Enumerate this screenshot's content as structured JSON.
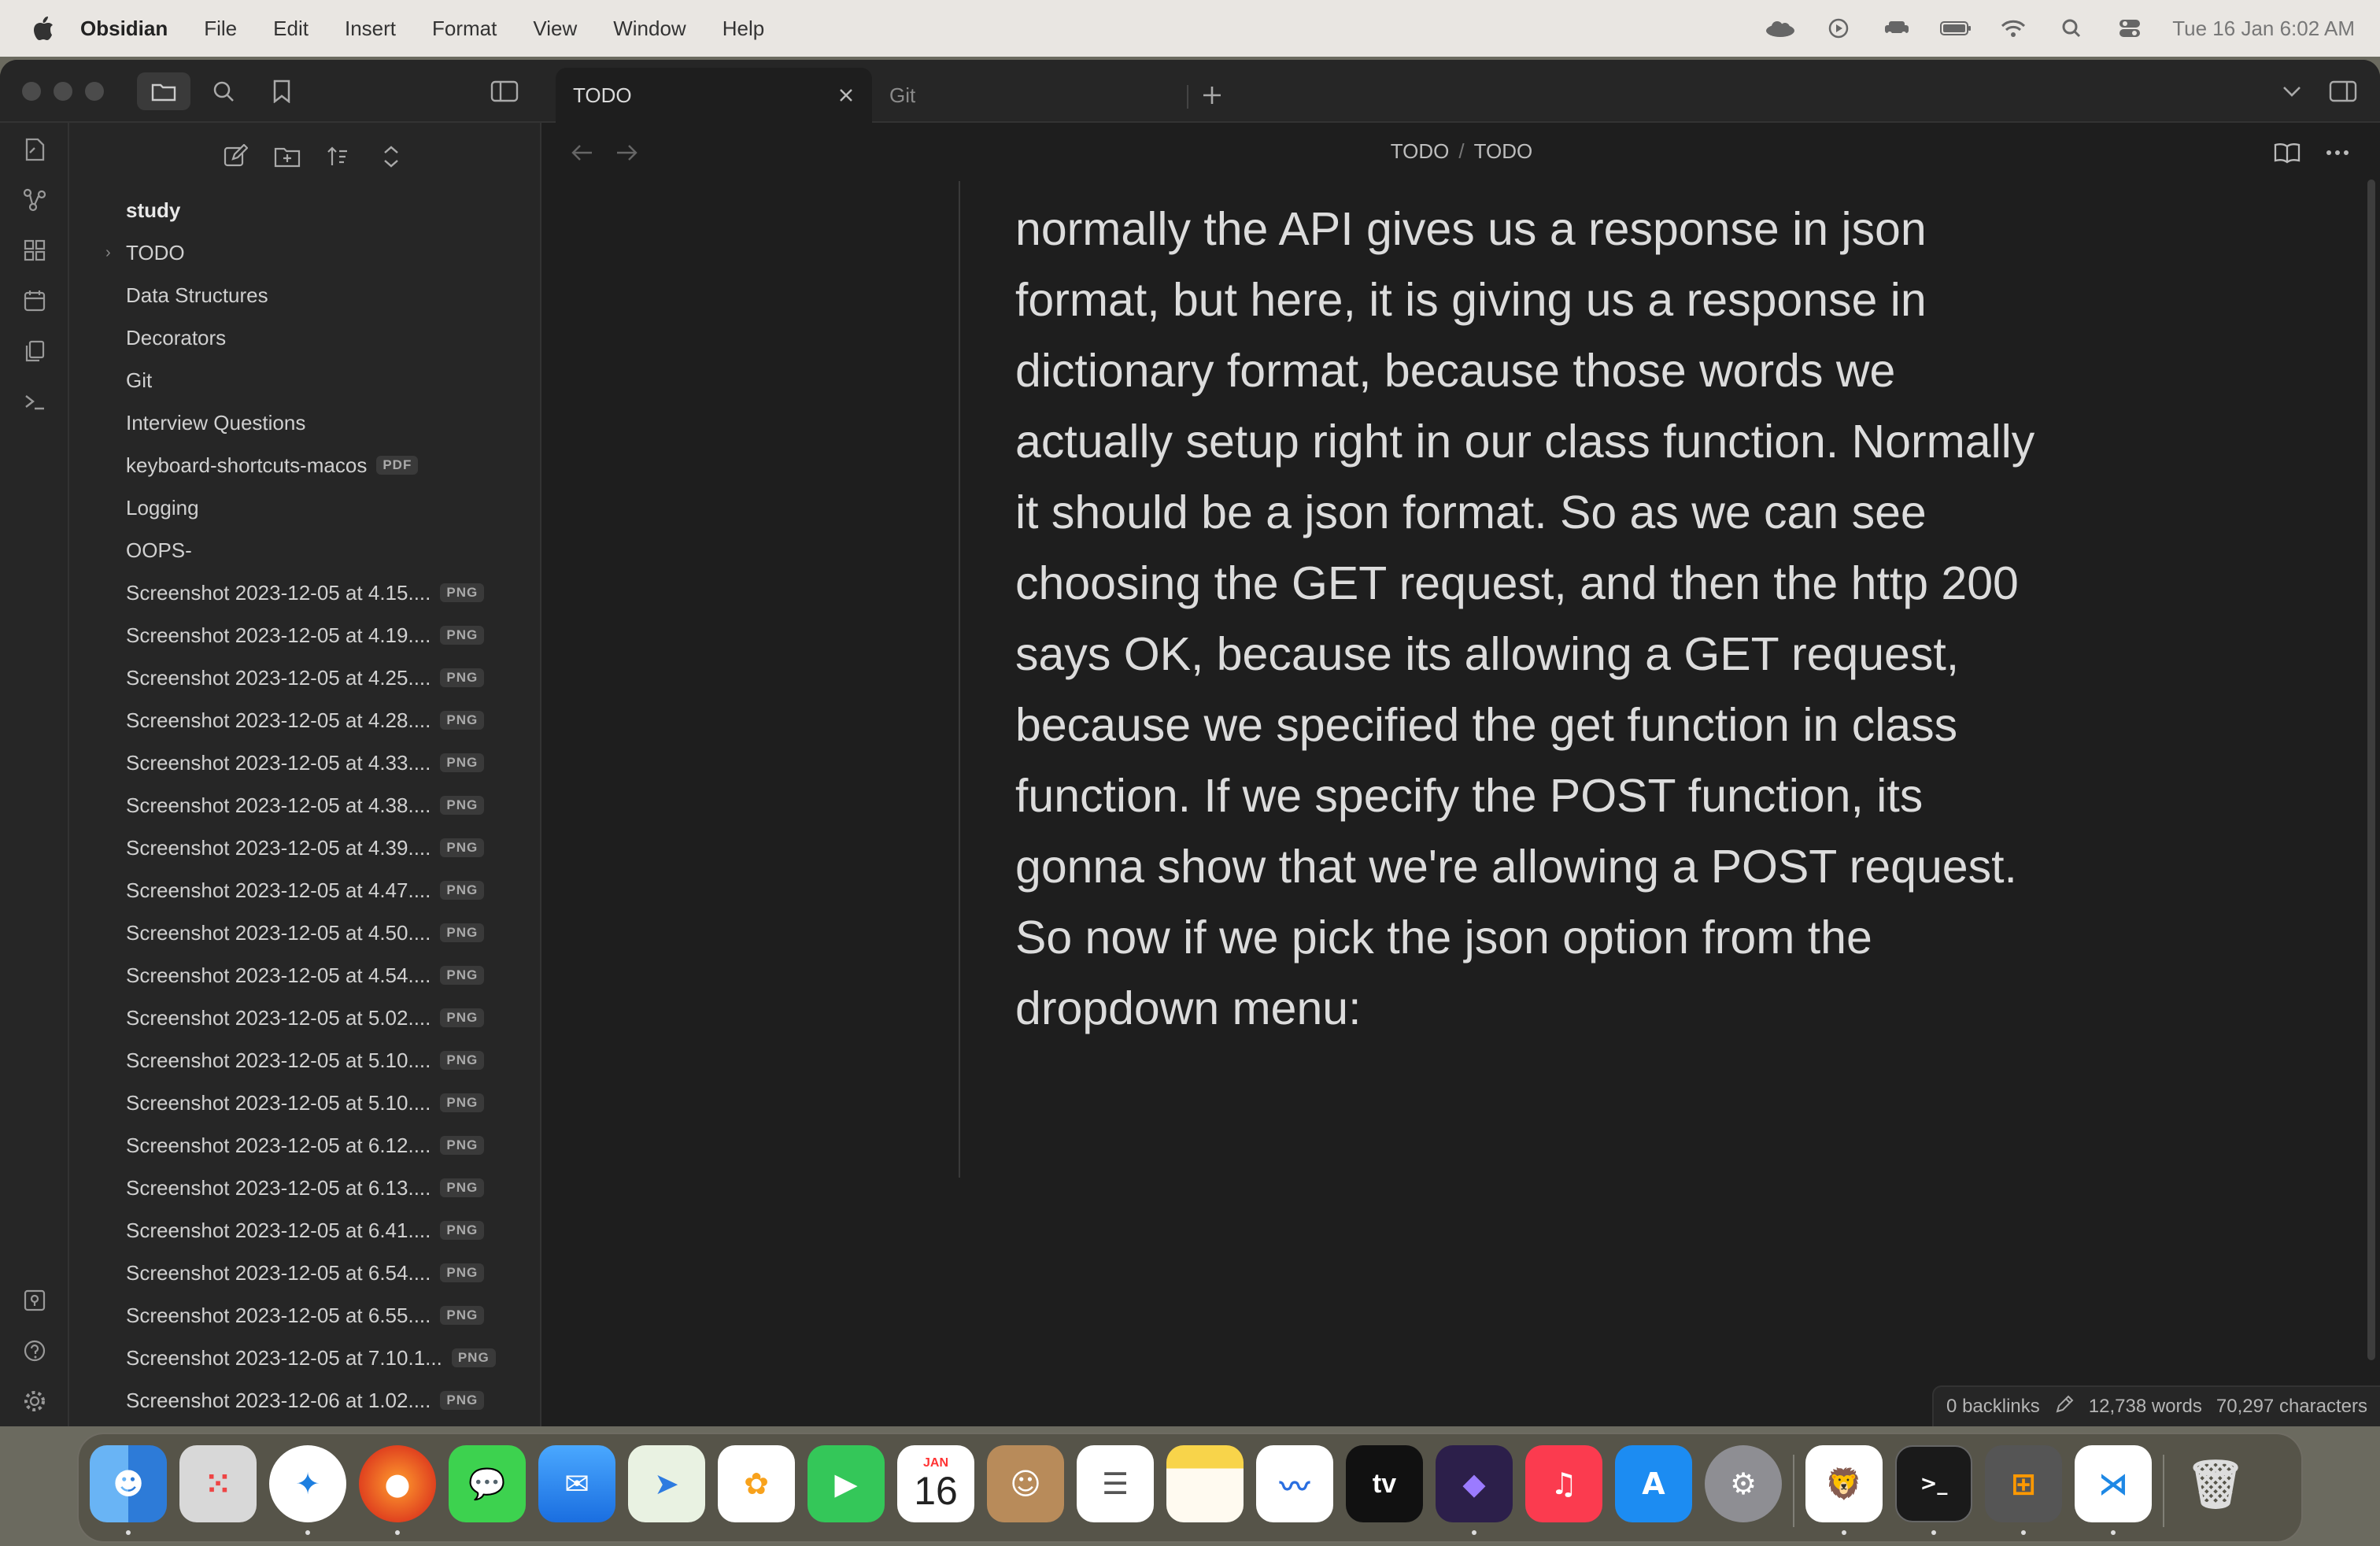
{
  "menubar": {
    "apple_icon": "apple-icon",
    "app_name": "Obsidian",
    "items": [
      "File",
      "Edit",
      "Insert",
      "Format",
      "View",
      "Window",
      "Help"
    ],
    "status_icons": [
      "cloud-icon",
      "play-circle-icon",
      "car-icon",
      "battery-icon",
      "wifi-icon",
      "search-icon",
      "control-center-icon"
    ],
    "clock": "Tue 16 Jan  6:02 AM"
  },
  "tabs": [
    {
      "label": "TODO",
      "active": true
    },
    {
      "label": "Git",
      "active": false
    }
  ],
  "breadcrumb": {
    "folder": "TODO",
    "separator": "/",
    "file": "TODO"
  },
  "sidebar": {
    "root": "study",
    "items": [
      {
        "name": "TODO",
        "badge": "",
        "folder": true
      },
      {
        "name": "Data Structures",
        "badge": ""
      },
      {
        "name": "Decorators",
        "badge": ""
      },
      {
        "name": "Git",
        "badge": ""
      },
      {
        "name": "Interview Questions",
        "badge": ""
      },
      {
        "name": "keyboard-shortcuts-macos",
        "badge": "PDF"
      },
      {
        "name": "Logging",
        "badge": ""
      },
      {
        "name": "OOPS-",
        "badge": ""
      },
      {
        "name": "Screenshot 2023-12-05 at 4.15....",
        "badge": "PNG"
      },
      {
        "name": "Screenshot 2023-12-05 at 4.19....",
        "badge": "PNG"
      },
      {
        "name": "Screenshot 2023-12-05 at 4.25....",
        "badge": "PNG"
      },
      {
        "name": "Screenshot 2023-12-05 at 4.28....",
        "badge": "PNG"
      },
      {
        "name": "Screenshot 2023-12-05 at 4.33....",
        "badge": "PNG"
      },
      {
        "name": "Screenshot 2023-12-05 at 4.38....",
        "badge": "PNG"
      },
      {
        "name": "Screenshot 2023-12-05 at 4.39....",
        "badge": "PNG"
      },
      {
        "name": "Screenshot 2023-12-05 at 4.47....",
        "badge": "PNG"
      },
      {
        "name": "Screenshot 2023-12-05 at 4.50....",
        "badge": "PNG"
      },
      {
        "name": "Screenshot 2023-12-05 at 4.54....",
        "badge": "PNG"
      },
      {
        "name": "Screenshot 2023-12-05 at 5.02....",
        "badge": "PNG"
      },
      {
        "name": "Screenshot 2023-12-05 at 5.10....",
        "badge": "PNG"
      },
      {
        "name": "Screenshot 2023-12-05 at 5.10....",
        "badge": "PNG"
      },
      {
        "name": "Screenshot 2023-12-05 at 6.12....",
        "badge": "PNG"
      },
      {
        "name": "Screenshot 2023-12-05 at 6.13....",
        "badge": "PNG"
      },
      {
        "name": "Screenshot 2023-12-05 at 6.41....",
        "badge": "PNG"
      },
      {
        "name": "Screenshot 2023-12-05 at 6.54....",
        "badge": "PNG"
      },
      {
        "name": "Screenshot 2023-12-05 at 6.55....",
        "badge": "PNG"
      },
      {
        "name": "Screenshot 2023-12-05 at 7.10.1...",
        "badge": "PNG"
      },
      {
        "name": "Screenshot 2023-12-06 at 1.02....",
        "badge": "PNG"
      }
    ]
  },
  "editor": {
    "paragraphs": [
      "normally the API gives us a response in json format, but here, it is giving us a response in dictionary format, because those words we actually setup right in our class function. Normally it should be a json format. So as we can see choosing the GET request, and then the http 200 says OK, because its allowing a GET request, because we specified the get function in class function. If we specify the POST function, its gonna show that we're allowing a POST request.",
      "So now if we pick the json option from the dropdown menu:"
    ]
  },
  "statusbar": {
    "backlinks": "0 backlinks",
    "words": "12,738 words",
    "characters": "70,297 characters"
  },
  "dock": {
    "apps": [
      "finder-icon",
      "launchpad-icon",
      "safari-icon",
      "firefox-icon",
      "messages-icon",
      "mail-icon",
      "maps-icon",
      "photos-icon",
      "facetime-icon",
      "calendar-icon",
      "contacts-icon",
      "reminders-icon",
      "notes-icon",
      "freeform-icon",
      "tv-icon",
      "obsidian-icon",
      "music-icon",
      "app-store-icon",
      "system-settings-icon",
      "brave-icon",
      "terminal-icon",
      "calculator-icon",
      "vscode-icon",
      "trash-icon"
    ],
    "calendar_month": "JAN",
    "calendar_day": "16",
    "tv_label": "tv"
  },
  "colors": {
    "window_bg": "#1e1e1e",
    "sidebar_bg": "#262626",
    "text": "#dcdcdc",
    "accent": "#7f6df2"
  }
}
